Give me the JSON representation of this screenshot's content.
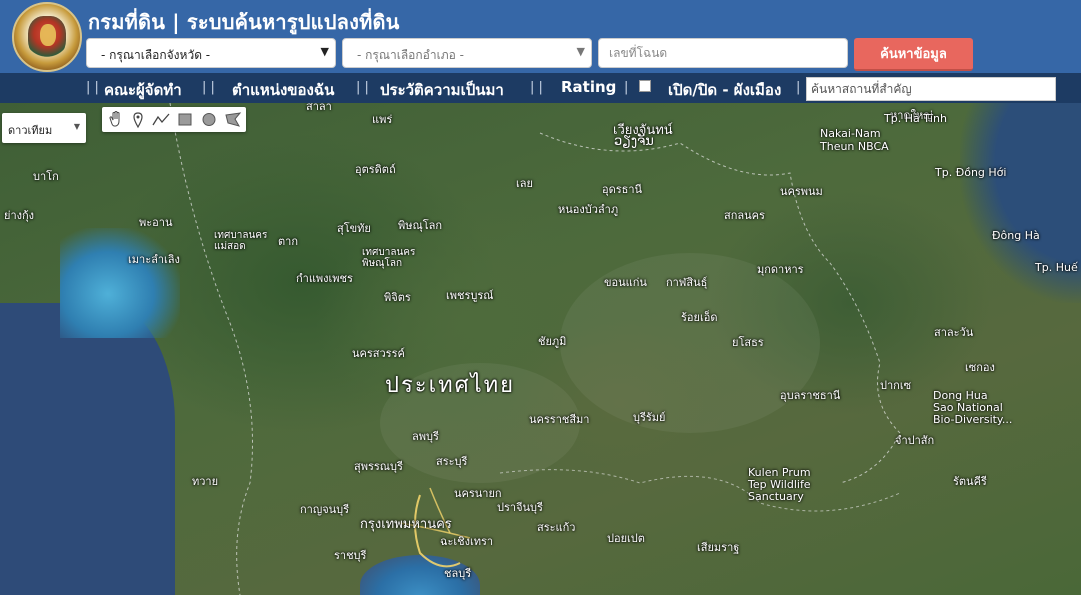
{
  "header": {
    "title": "กรมที่ดิน | ระบบค้นหารูปแปลงที่ดิน",
    "province_select": "- กรุณาเลือกจังหวัด -",
    "district_select": "- กรุณาเลือกอำเภอ -",
    "deed_placeholder": "เลขที่โฉนด",
    "search_button": "ค้นหาข้อมูล"
  },
  "nav": {
    "items": [
      {
        "label": "คณะผู้จัดทำ"
      },
      {
        "label": "ตำแหน่งของฉัน"
      },
      {
        "label": "ประวัติความเป็นมา"
      },
      {
        "label": "Rating"
      },
      {
        "label": "เปิด/ปิด - ผังเมือง"
      }
    ],
    "place_search_placeholder": "ค้นหาสถานที่สำคัญ"
  },
  "map": {
    "type_select": "ดาวเทียม",
    "draw_tools": [
      "hand-icon",
      "marker-icon",
      "polyline-icon",
      "rectangle-icon",
      "circle-icon",
      "polygon-icon"
    ],
    "labels": {
      "country": "ประเทศไทย",
      "bangkok": "กรุงเทพมหานคร",
      "vientiane": "เวียงจันทน์",
      "vientiane_lao": "ວຽງຈັນ",
      "phrae": "แพร่",
      "uttaradit": "อุตรดิตถ์",
      "loei": "เลย",
      "udonthani": "อุดรธานี",
      "nongbualamphu": "หนองบัวลำภู",
      "sakonnakhon": "สกลนคร",
      "nakhonphanom": "นครพนม",
      "sukhothai": "สุโขทัย",
      "phitsanulok": "พิษณุโลก",
      "tak": "ตาก",
      "khonkaen": "ขอนแก่น",
      "kalasin": "กาฬสินธุ์",
      "mukdahan": "มุกดาหาร",
      "kamphaengphet": "กำแพงเพชร",
      "phichit": "พิจิตร",
      "phetchabun": "เพชรบูรณ์",
      "roiet": "ร้อยเอ็ด",
      "chaiyaphum": "ชัยภูมิ",
      "yasothon": "ยโสธร",
      "nakhonsawan": "นครสวรรค์",
      "ubon": "อุบลราชธานี",
      "nakhonratchasima": "นครราชสีมา",
      "buriram": "บุรีรัมย์",
      "lopburi": "ลพบุรี",
      "suphanburi": "สุพรรณบุรี",
      "saraburi": "สระบุรี",
      "nakhonnayok": "นครนายก",
      "kanchanaburi": "กาญจนบุรี",
      "prachinburi": "ปราจีนบุรี",
      "sakaeo": "สระแก้ว",
      "chachoengsao": "ฉะเชิงเทรา",
      "ratchaburi": "ราชบุรี",
      "chonburi": "ชลบุรี",
      "nakai": "Nakai-Nam\nTheun NBCA",
      "tp_hatinh": "Tp. Hà Tĩnh",
      "tp_donghoi": "Tp. Đồng Hới",
      "dongha": "Đông Hà",
      "tp_hue": "Tp. Huế",
      "donghua": "Dong Hua\nSao National\nBio-Diversity...",
      "kulen": "Kulen Prum\nTep Wildlife\nSanctuary",
      "pakse": "ปากเซ",
      "thawai": "ทวาย",
      "mawlamyine": "เมาะลำเลิง",
      "yangon": "ย่างกุ้ง",
      "bago": "บาโก",
      "phaan": "พะอาน",
      "salawan": "สาละวัน",
      "sekong": "เซกอง",
      "champasak": "จำปาสัก",
      "sisaket_kh": "เสียมราฐ",
      "banteay": "ปอยเปต",
      "stung": "สตึงแตรง",
      "kratie": "รัตนคีรี",
      "chomphu": "เทศบาลนคร",
      "phitsanulok2": "เทศบาลนคร\nพิษณุโลก",
      "mae_sot": "เทศบาลนคร\nแม่สอด",
      "hat_dat": "หาดใหญ่",
      "sala": "สาลา"
    }
  }
}
